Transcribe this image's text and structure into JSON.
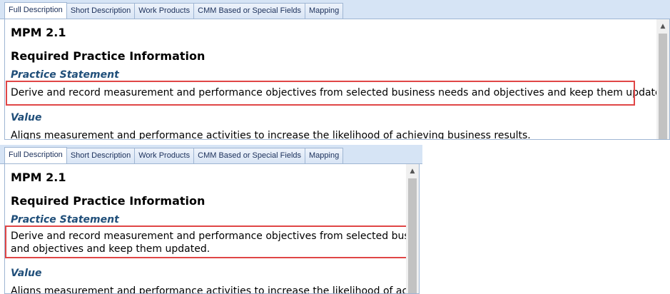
{
  "tabs": [
    "Full Description",
    "Short Description",
    "Work Products",
    "CMM Based or Special Fields",
    "Mapping"
  ],
  "practice_id": "MPM 2.1",
  "section_heading": "Required Practice Information",
  "practice_statement_label": "Practice Statement",
  "practice_statement": "Derive and record measurement and performance objectives from selected business needs and objectives and keep them updated.",
  "practice_statement_wrapped": {
    "line1": "Derive and record measurement and performance objectives from selected business",
    "line2": "and objectives and keep them updated."
  },
  "value_label": "Value",
  "value_text": "Aligns measurement and performance activities to increase the likelihood of achieving business results.",
  "value_text_truncated": "Aligns measurement and performance activities to increase the likelihood of achieving",
  "scroll_up_glyph": "▲",
  "colors": {
    "highlight": "#e04646",
    "subheading": "#1f4e79",
    "tabbar": "#d6e4f5"
  }
}
